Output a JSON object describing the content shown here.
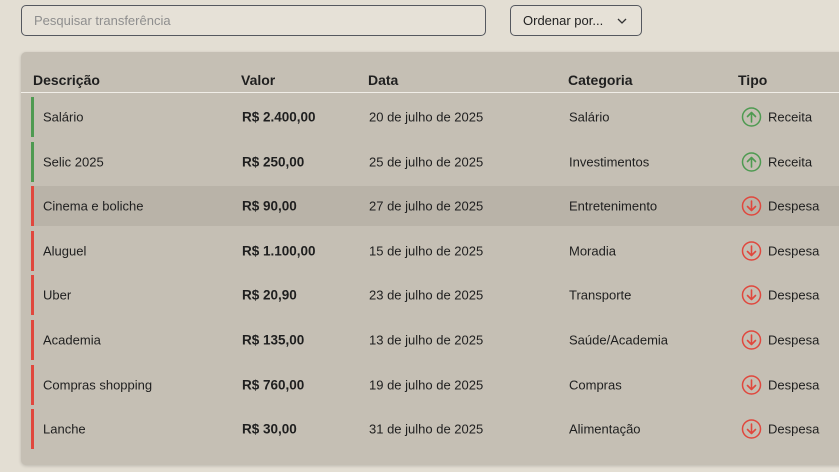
{
  "search": {
    "placeholder": "Pesquisar transferência"
  },
  "sort": {
    "label": "Ordenar por..."
  },
  "table": {
    "headers": {
      "descricao": "Descrição",
      "valor": "Valor",
      "data": "Data",
      "categoria": "Categoria",
      "tipo": "Tipo"
    },
    "rows": [
      {
        "descricao": "Salário",
        "valor": "R$ 2.400,00",
        "data": "20 de julho de 2025",
        "categoria": "Salário",
        "tipo": "Receita",
        "kind": "receita"
      },
      {
        "descricao": "Selic 2025",
        "valor": "R$ 250,00",
        "data": "25 de julho de 2025",
        "categoria": "Investimentos",
        "tipo": "Receita",
        "kind": "receita"
      },
      {
        "descricao": "Cinema e boliche",
        "valor": "R$ 90,00",
        "data": "27 de julho de 2025",
        "categoria": "Entretenimento",
        "tipo": "Despesa",
        "kind": "despesa",
        "highlighted": true
      },
      {
        "descricao": "Aluguel",
        "valor": "R$ 1.100,00",
        "data": "15 de julho de 2025",
        "categoria": "Moradia",
        "tipo": "Despesa",
        "kind": "despesa"
      },
      {
        "descricao": "Uber",
        "valor": "R$ 20,90",
        "data": "23 de julho de 2025",
        "categoria": "Transporte",
        "tipo": "Despesa",
        "kind": "despesa"
      },
      {
        "descricao": "Academia",
        "valor": "R$ 135,00",
        "data": "13 de julho de 2025",
        "categoria": "Saúde/Academia",
        "tipo": "Despesa",
        "kind": "despesa"
      },
      {
        "descricao": "Compras shopping",
        "valor": "R$ 760,00",
        "data": "19 de julho de 2025",
        "categoria": "Compras",
        "tipo": "Despesa",
        "kind": "despesa"
      },
      {
        "descricao": "Lanche",
        "valor": "R$ 30,00",
        "data": "31 de julho de 2025",
        "categoria": "Alimentação",
        "tipo": "Despesa",
        "kind": "despesa"
      }
    ]
  },
  "icons": {
    "receita": "arrow-up-circle-icon",
    "despesa": "arrow-down-circle-icon",
    "sort": "chevron-down-icon"
  },
  "colors": {
    "receita": "#4e9a51",
    "despesa": "#e0473d",
    "panel": "#c5bfb4",
    "background": "#e3ded3"
  }
}
